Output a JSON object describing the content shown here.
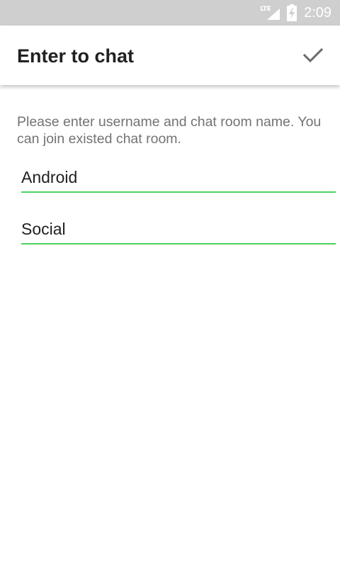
{
  "status_bar": {
    "network_label": "LTE",
    "time": "2:09",
    "icons": [
      "lte-signal-icon",
      "battery-charging-icon"
    ]
  },
  "app_bar": {
    "title": "Enter to chat",
    "confirm_icon": "checkmark-icon"
  },
  "form": {
    "instructions": "Please enter username and chat room name. You can join existed chat room.",
    "username_value": "Android",
    "room_value": "Social"
  },
  "colors": {
    "accent": "#4cd15f",
    "status_bar_bg": "#cfcfcf",
    "title_text": "#212121",
    "secondary_text": "#737373"
  }
}
